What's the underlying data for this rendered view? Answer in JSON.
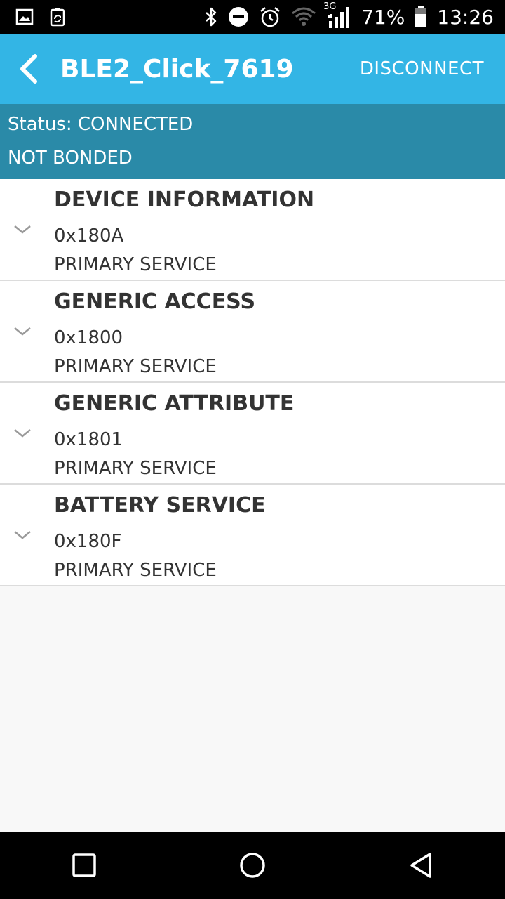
{
  "status_bar": {
    "left_icons": [
      "gallery-icon",
      "recycle-icon"
    ],
    "right_icons": [
      "bluetooth-icon",
      "dnd-icon",
      "alarm-icon",
      "wifi-icon",
      "signal-icon"
    ],
    "network_type": "3G",
    "battery_percent": "71%",
    "time": "13:26",
    "colors": {
      "background": "#000000",
      "foreground": "#ffffff"
    }
  },
  "app_bar": {
    "back_icon": "chevron-left-icon",
    "title": "BLE2_Click_7619",
    "action_label": "DISCONNECT",
    "color": "#33b5e5"
  },
  "connection": {
    "status_text": "Status: CONNECTED",
    "bond_text": "NOT BONDED",
    "color": "#2a8aa8"
  },
  "services": [
    {
      "name": "DEVICE INFORMATION",
      "uuid": "0x180A",
      "type": "PRIMARY SERVICE"
    },
    {
      "name": "GENERIC ACCESS",
      "uuid": "0x1800",
      "type": "PRIMARY SERVICE"
    },
    {
      "name": "GENERIC ATTRIBUTE",
      "uuid": "0x1801",
      "type": "PRIMARY SERVICE"
    },
    {
      "name": "BATTERY SERVICE",
      "uuid": "0x180F",
      "type": "PRIMARY SERVICE"
    }
  ],
  "nav_bar": {
    "icons": [
      "recents-icon",
      "home-icon",
      "back-icon"
    ]
  }
}
